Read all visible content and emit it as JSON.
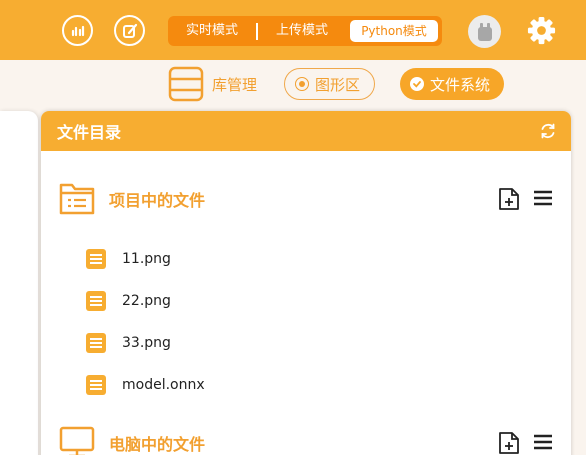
{
  "topbar": {
    "icons": [
      "chart-icon",
      "edit-icon"
    ],
    "modes": [
      "实时模式",
      "上传模式",
      "Python模式"
    ],
    "active_mode": "Python模式",
    "avatar_icon": "robot-avatar-icon",
    "settings_icon": "gear-icon"
  },
  "nav": {
    "library": "库管理",
    "graph": "图形区",
    "files": "文件系统"
  },
  "panel": {
    "title": "文件目录",
    "refresh_icon": "refresh-icon",
    "sections": [
      {
        "title": "项目中的文件",
        "files": [
          "11.png",
          "22.png",
          "33.png",
          "model.onnx"
        ]
      },
      {
        "title": "电脑中的文件",
        "files": []
      }
    ]
  },
  "colors": {
    "accent": "#f7ad31",
    "accent_dark": "#f58a0e",
    "background": "#faf4ee"
  }
}
